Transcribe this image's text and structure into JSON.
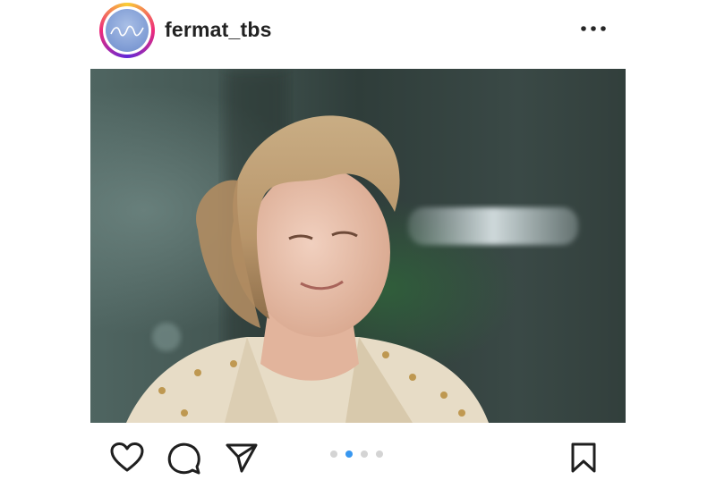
{
  "post": {
    "username": "fermat_tbs",
    "avatar_icon": "profile-avatar",
    "image_icon": "post-photo",
    "carousel": {
      "count": 4,
      "active_index": 1
    },
    "actions": [
      "heart-icon",
      "comment-icon",
      "share-icon",
      "bookmark-icon"
    ],
    "more_icon": "more-horizontal-icon"
  },
  "colors": {
    "accent": "#3897f0",
    "text": "#222222"
  }
}
